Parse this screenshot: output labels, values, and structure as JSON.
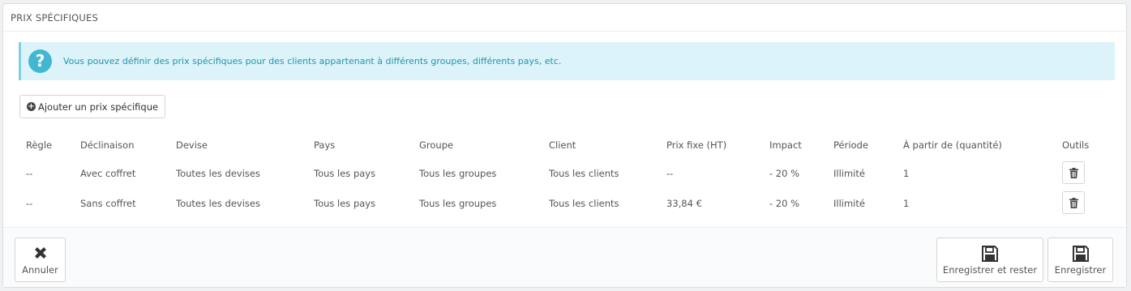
{
  "panel": {
    "title": "PRIX SPÉCIFIQUES",
    "info": "Vous pouvez définir des prix spécifiques pour des clients appartenant à différents groupes, différents pays, etc.",
    "info_icon": "?",
    "add_button": "Ajouter un prix spécifique"
  },
  "table": {
    "headers": [
      "Règle",
      "Déclinaison",
      "Devise",
      "Pays",
      "Groupe",
      "Client",
      "Prix fixe (HT)",
      "Impact",
      "Période",
      "À partir de (quantité)",
      "Outils"
    ],
    "rows": [
      [
        "--",
        "Avec coffret",
        "Toutes les devises",
        "Tous les pays",
        "Tous les groupes",
        "Tous les clients",
        "--",
        "- 20 %",
        "Illimité",
        "1"
      ],
      [
        "--",
        "Sans coffret",
        "Toutes les devises",
        "Tous les pays",
        "Tous les groupes",
        "Tous les clients",
        "33,84 €",
        "- 20 %",
        "Illimité",
        "1"
      ]
    ],
    "row_action_icon": "trash-icon"
  },
  "footer": {
    "cancel": "Annuler",
    "save_stay": "Enregistrer et rester",
    "save": "Enregistrer"
  }
}
